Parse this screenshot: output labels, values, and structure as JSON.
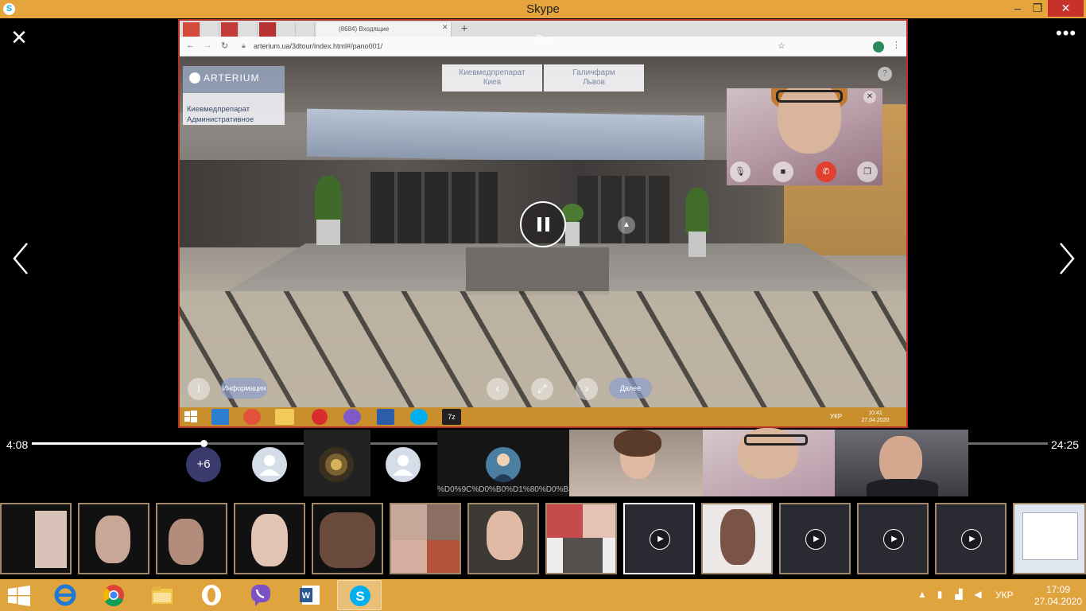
{
  "window": {
    "title": "Skype",
    "min": "–",
    "max": "❐",
    "close": "✕"
  },
  "viewer": {
    "close_glyph": "✕",
    "more_glyph": "•••",
    "you_label": "Вы"
  },
  "shared_screen": {
    "browser_tab_active": "(8684) Входящие",
    "address": "arterium.ua/3dtour/index.html#/pano001/",
    "brand": "ARTERIUM",
    "location_line1": "Киевмедпрепарат",
    "location_line2": "Административное",
    "tour_tabs": [
      {
        "line1": "Киевмедпрепарат",
        "line2": "Киев"
      },
      {
        "line1": "Галичфарм",
        "line2": "Львов"
      }
    ],
    "help": "?",
    "info_button": "Информация",
    "next_button": "Далее",
    "inner_lang": "УКР",
    "inner_time": "10:41",
    "inner_date": "27.04.2020"
  },
  "progress": {
    "current": "4:08",
    "total": "24:25",
    "fraction": 0.169
  },
  "participants": {
    "more_count": "+6",
    "name_label": "%D0%9C%D0%B0%D1%80%D0%B3..."
  },
  "taskbar": {
    "lang": "УКР",
    "time": "17:09",
    "date": "27.04.2020"
  },
  "colors": {
    "accent": "#e6a43c",
    "skype": "#00aff0",
    "close": "#c7312a"
  }
}
